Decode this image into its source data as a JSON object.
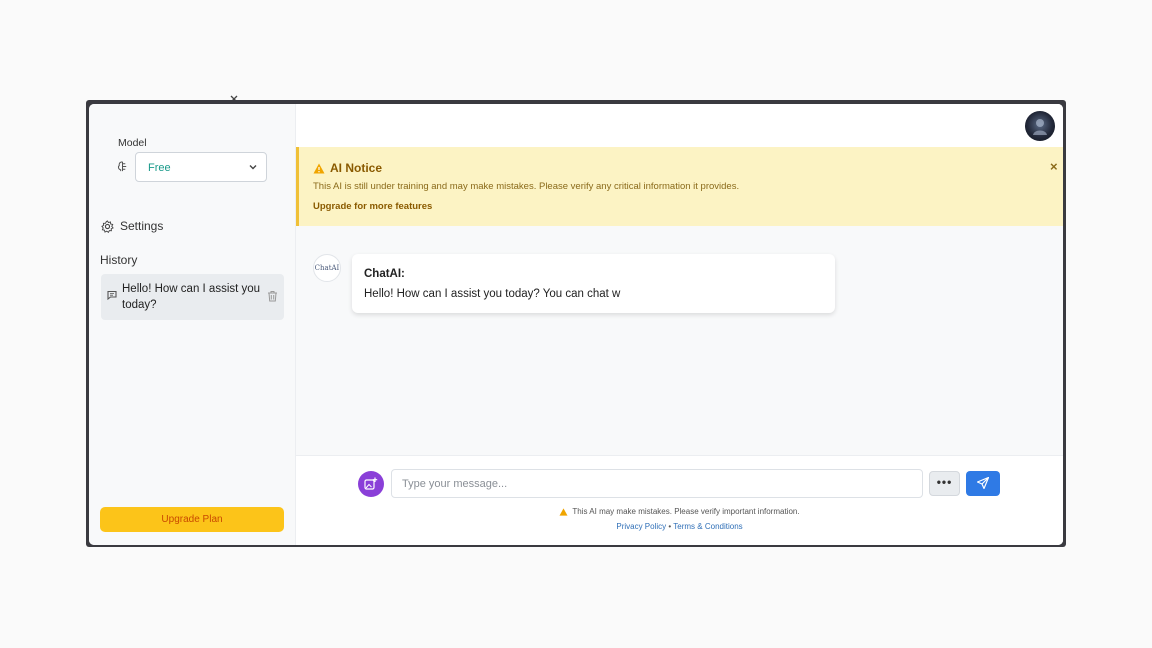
{
  "sidebar": {
    "model_label": "Model",
    "model_value": "Free",
    "settings_label": "Settings",
    "history_title": "History",
    "history_items": [
      {
        "text": "Hello! How can I assist you today?"
      }
    ],
    "upgrade_label": "Upgrade Plan"
  },
  "notice": {
    "title": "AI Notice",
    "message": "This AI is still under training and may make mistakes. Please verify any critical information it provides.",
    "link": "Upgrade for more features",
    "close": "×"
  },
  "chat": {
    "bot_avatar_text": "ChatAI",
    "messages": [
      {
        "sender": "ChatAI:",
        "text": "Hello! How can I assist you today? You can chat w"
      }
    ]
  },
  "composer": {
    "placeholder": "Type your message...",
    "more_label": "•••",
    "disclaimer": "This AI may make mistakes. Please verify important information.",
    "privacy_label": "Privacy Policy",
    "separator": "•",
    "terms_label": "Terms & Conditions"
  },
  "colors": {
    "accent_blue": "#2f7ae5",
    "upgrade_yellow": "#fcc419",
    "notice_bg": "#fcf3c4",
    "attach_purple": "#8a3fd8"
  },
  "icons": [
    "brain-icon",
    "chevron-down-icon",
    "gear-icon",
    "chat-bubble-icon",
    "trash-icon",
    "warning-icon",
    "close-icon",
    "image-attach-icon",
    "send-icon",
    "user-avatar"
  ]
}
